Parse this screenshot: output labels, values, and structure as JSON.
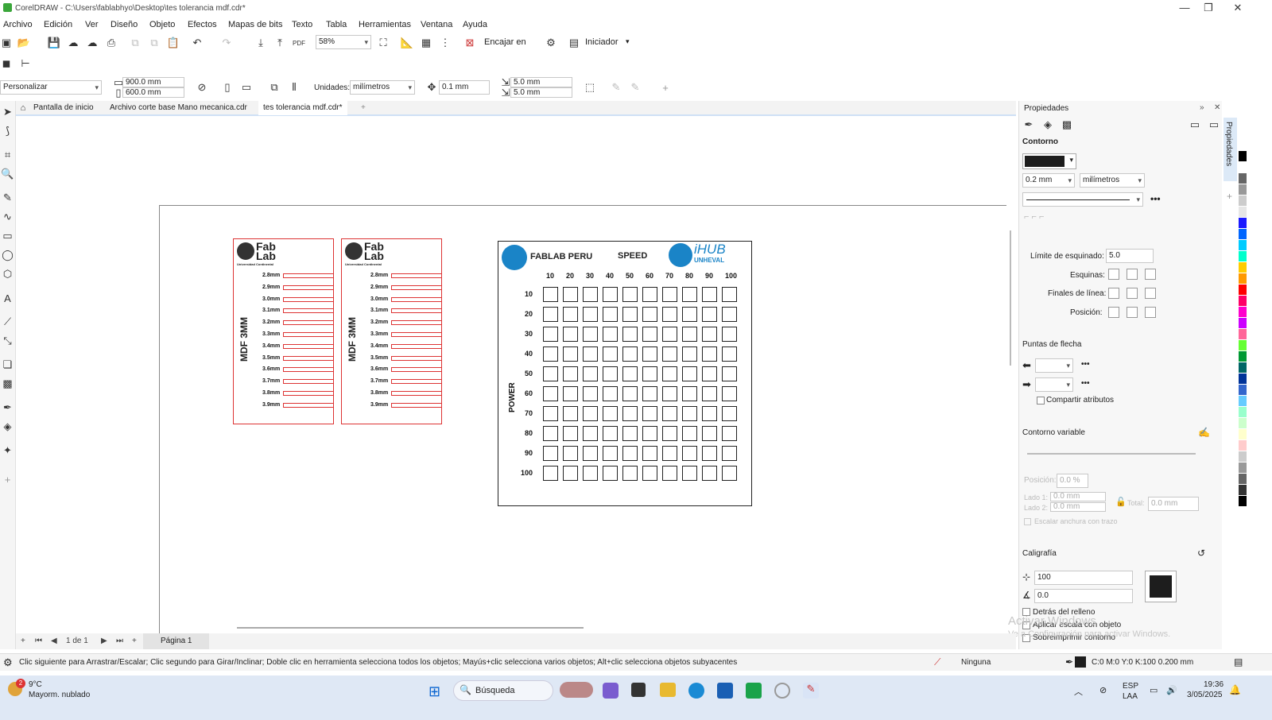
{
  "window": {
    "title": "CorelDRAW - C:\\Users\\fablabhyo\\Desktop\\tes tolerancia mdf.cdr*"
  },
  "menu": [
    "Archivo",
    "Edición",
    "Ver",
    "Diseño",
    "Objeto",
    "Efectos",
    "Mapas de bits",
    "Texto",
    "Tabla",
    "Herramientas",
    "Ventana",
    "Ayuda"
  ],
  "toolbar": {
    "zoom": "58%",
    "snap_label": "Encajar en",
    "launcher_label": "Iniciador"
  },
  "propbar": {
    "preset": "Personalizar",
    "width": "900.0 mm",
    "height": "600.0 mm",
    "units_label": "Unidades:",
    "units": "milímetros",
    "nudge": "0.1 mm",
    "dup_x": "5.0 mm",
    "dup_y": "5.0 mm"
  },
  "tabs": [
    "Pantalla de inicio",
    "Archivo corte base Mano mecanica.cdr",
    "tes tolerancia mdf.cdr*"
  ],
  "drawing": {
    "card_label": "MDF 3MM",
    "logo_top": "Fab",
    "logo_bottom": "Lab",
    "logo_sub": "Universidad Continental",
    "tolerances": [
      "2.8mm",
      "2.9mm",
      "3.0mm",
      "3.1mm",
      "3.2mm",
      "3.3mm",
      "3.4mm",
      "3.5mm",
      "3.6mm",
      "3.7mm",
      "3.8mm",
      "3.9mm"
    ],
    "grid_brand": "FABLAB PERU",
    "grid_brand2": "iHUB",
    "grid_brand2_sub": "UNHEVAL",
    "speed_label": "SPEED",
    "power_label": "POWER",
    "speed_values": [
      "10",
      "20",
      "30",
      "40",
      "50",
      "60",
      "70",
      "80",
      "90",
      "100"
    ],
    "power_values": [
      "10",
      "20",
      "30",
      "40",
      "50",
      "60",
      "70",
      "80",
      "90",
      "100"
    ]
  },
  "properties": {
    "title": "Propiedades",
    "side_tab": "Propiedades",
    "contour_title": "Contorno",
    "width": "0.2 mm",
    "units": "milímetros",
    "miter_label": "Límite de esquinado:",
    "miter_value": "5.0",
    "corners_label": "Esquinas:",
    "line_ends_label": "Finales de línea:",
    "position_label": "Posición:",
    "arrows_title": "Puntas de flecha",
    "share_attrs": "Compartir atributos",
    "variable_title": "Contorno variable",
    "var_position_label": "Posición:",
    "var_position_value": "0.0 %",
    "side1_label": "Lado 1:",
    "side1_value": "0.0 mm",
    "side2_label": "Lado 2:",
    "side2_value": "0.0 mm",
    "total_label": "Total:",
    "total_value": "0.0 mm",
    "scale_width": "Escalar anchura con trazo",
    "calligraphy_title": "Caligrafía",
    "stretch": "100",
    "angle": "0.0",
    "behind_fill": "Detrás del relleno",
    "scale_with_object": "Aplicar escala con objeto",
    "overprint": "Sobreimprimir contorno",
    "watermark1": "Activar Windows",
    "watermark2": "Ve a Configuración para activar Windows."
  },
  "pagenav": {
    "count": "1 de 1",
    "page_tab": "Página 1"
  },
  "status": {
    "hint": "Clic siguiente para Arrastrar/Escalar; Clic segundo para Girar/Inclinar; Doble clic en herramienta selecciona todos los objetos; Mayús+clic selecciona varios objetos; Alt+clic selecciona objetos subyacentes",
    "fill": "Ninguna",
    "outline": "C:0 M:0 Y:0 K:100  0.200 mm"
  },
  "taskbar": {
    "temp": "9°C",
    "weather": "Mayorm. nublado",
    "badge": "2",
    "search": "Búsqueda",
    "lang1": "ESP",
    "lang2": "LAA",
    "time": "19:36",
    "date": "3/05/2025"
  },
  "palette_colors": [
    "#000000",
    "#ffffff",
    "#666666",
    "#999999",
    "#cccccc",
    "#e6e6e6",
    "#1a1aff",
    "#0066ff",
    "#00ccff",
    "#00ffcc",
    "#ffcc00",
    "#ff9900",
    "#ff0000",
    "#ff0066",
    "#ff00cc",
    "#cc00ff",
    "#ff6699",
    "#66ff33",
    "#009933",
    "#006666",
    "#003399",
    "#3366cc",
    "#66ccff",
    "#99ffcc",
    "#ccffcc",
    "#ffffcc",
    "#ffcccc",
    "#cccccc",
    "#999999",
    "#666666",
    "#333333",
    "#000000"
  ]
}
